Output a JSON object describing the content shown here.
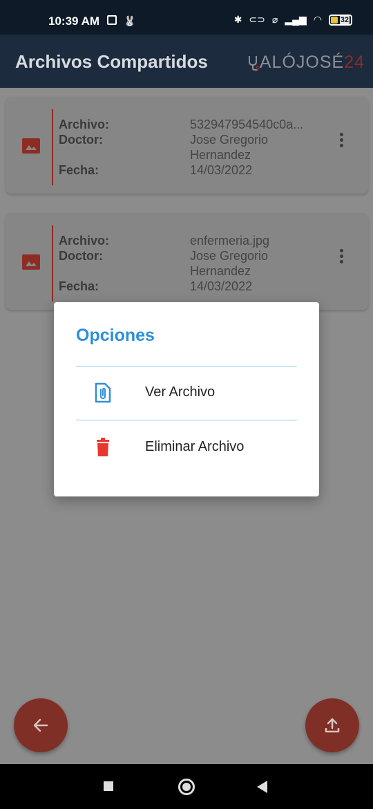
{
  "status": {
    "time": "10:39 AM",
    "battery": "32"
  },
  "appbar": {
    "title": "Archivos Compartidos",
    "logo_text": "ALÓJOSÉ",
    "logo_num": "24"
  },
  "labels": {
    "archivo": "Archivo:",
    "doctor": "Doctor:",
    "fecha": "Fecha:"
  },
  "files": [
    {
      "archivo": "532947954540c0a...",
      "doctor_line1": "Jose Gregorio",
      "doctor_line2": "Hernandez",
      "fecha": "14/03/2022"
    },
    {
      "archivo": "enfermeria.jpg",
      "doctor_line1": "Jose Gregorio",
      "doctor_line2": "Hernandez",
      "fecha": "14/03/2022"
    }
  ],
  "dialog": {
    "title": "Opciones",
    "options": [
      {
        "label": "Ver Archivo",
        "icon": "attachment-file-icon",
        "color": "#2d8fd8"
      },
      {
        "label": "Eliminar Archivo",
        "icon": "trash-icon",
        "color": "#e8382e"
      }
    ]
  },
  "colors": {
    "accent": "#2d8fd8",
    "danger": "#e8382e",
    "brand": "#8e2b23",
    "appbar": "#1c2b3e"
  }
}
